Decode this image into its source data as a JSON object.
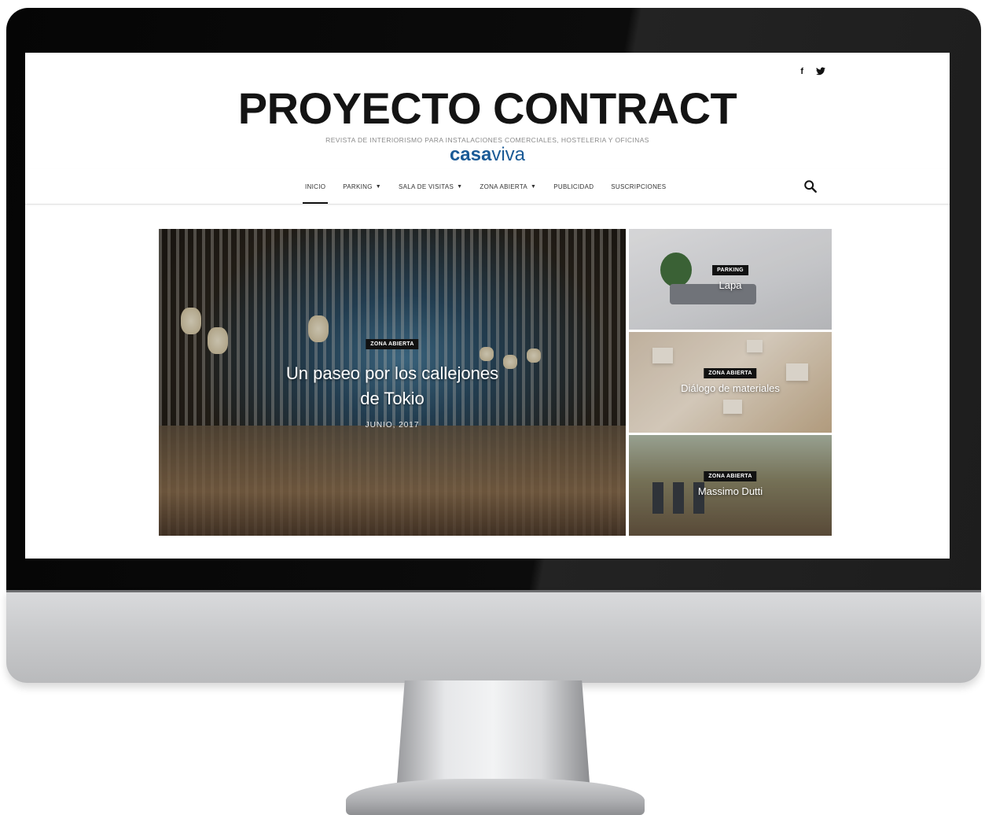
{
  "site": {
    "title": "PROYECTO CONTRACT",
    "tagline": "REVISTA DE INTERIORISMO PARA INSTALACIONES COMERCIALES, HOSTELERIA Y OFICINAS",
    "brand_part1": "casa",
    "brand_part2": "viva"
  },
  "social": {
    "facebook": "f",
    "twitter": "🐦"
  },
  "nav": {
    "items": [
      {
        "label": "INICIO",
        "dropdown": false,
        "active": true
      },
      {
        "label": "PARKING",
        "dropdown": true
      },
      {
        "label": "SALA DE VISITAS",
        "dropdown": true
      },
      {
        "label": "ZONA ABIERTA",
        "dropdown": true
      },
      {
        "label": "PUBLICIDAD",
        "dropdown": false
      },
      {
        "label": "SUSCRIPCIONES",
        "dropdown": false
      }
    ],
    "search_icon": "search-icon"
  },
  "featured": {
    "main": {
      "category": "ZONA ABIERTA",
      "title_line1": "Un paseo por los callejones",
      "title_line2": "de Tokio",
      "date": "JUNIO, 2017"
    },
    "side": [
      {
        "category": "PARKING",
        "title": "Lapa"
      },
      {
        "category": "ZONA ABIERTA",
        "title": "Diálogo de materiales"
      },
      {
        "category": "ZONA ABIERTA",
        "title": "Massimo Dutti"
      }
    ]
  }
}
